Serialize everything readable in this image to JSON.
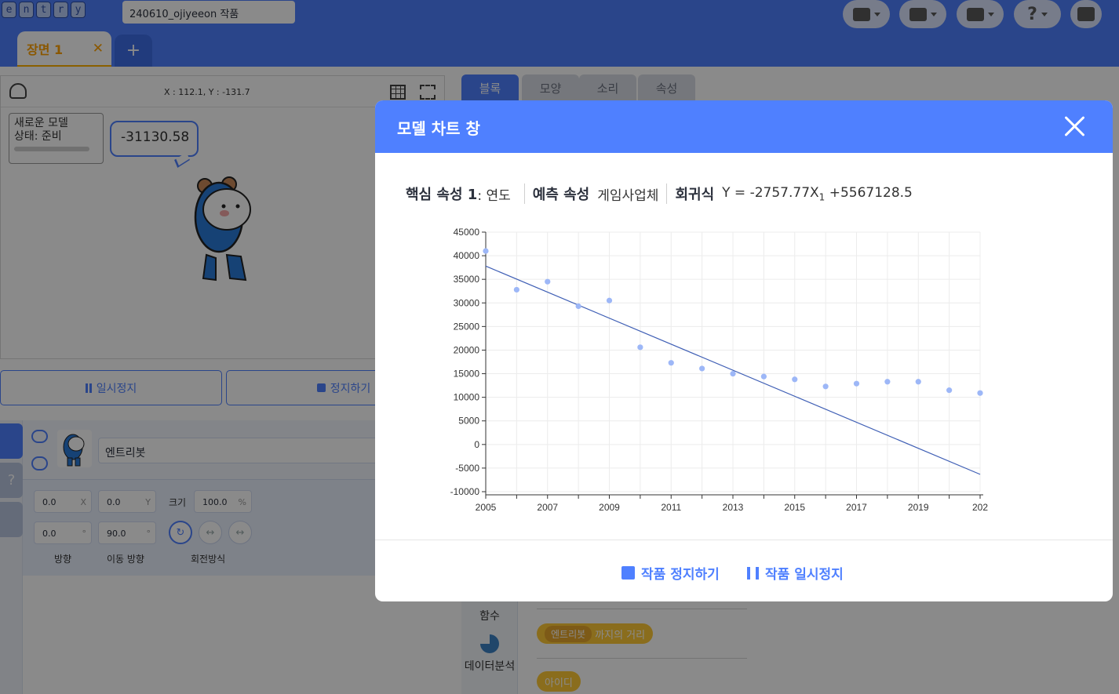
{
  "logo_letters": [
    "e",
    "n",
    "t",
    "r",
    "y"
  ],
  "project": {
    "title": "240610_ojiyeeon 작품"
  },
  "toolbar": {
    "icons": [
      "block-mode-icon",
      "file-icon",
      "save-icon",
      "help-icon",
      "print-icon"
    ],
    "help_label": "?"
  },
  "scene": {
    "tab_label": "장면 1",
    "close_glyph": "✕",
    "add_glyph": "+"
  },
  "stage": {
    "coords": "X : 112.1, Y : -131.7",
    "model_box": {
      "name": "새로운 모델",
      "status": "상태: 준비"
    },
    "bubble_text": "-31130.58"
  },
  "controls": {
    "pause_label": "일시정지",
    "stop_label": "정지하기"
  },
  "object": {
    "name": "엔트리봇",
    "x": "0.0",
    "y": "0.0",
    "x_unit": "X",
    "y_unit": "Y",
    "size_label": "크기",
    "size": "100.0",
    "size_unit": "%",
    "direction": "0.0",
    "move_direction": "90.0",
    "degree_unit": "°",
    "direction_label": "방향",
    "move_direction_label": "이동 방향",
    "rotation_label": "회전방식"
  },
  "block_tabs": [
    "블록",
    "모양",
    "소리",
    "속성"
  ],
  "categories": {
    "function": "함수",
    "data_analysis": "데이터분석"
  },
  "blocks": {
    "target": "엔트리봇",
    "distance": "까지의 거리",
    "id": "아이디"
  },
  "modal": {
    "title": "모델 차트 창",
    "core_label": "핵심 속성 1",
    "core_value": ": 연도",
    "predict_label": "예측 속성",
    "predict_value": "게임사업체",
    "formula_label": "회귀식",
    "formula_prefix": "Y = -2757.77X",
    "formula_sub": "1",
    "formula_suffix": " +5567128.5",
    "stop_label": "작품 정지하기",
    "pause_label": "작품 일시정지"
  },
  "chart_data": {
    "type": "scatter",
    "points_color": "#9db7f7",
    "line_color": "#3f5fb5",
    "x": [
      2005,
      2006,
      2007,
      2008,
      2009,
      2010,
      2011,
      2012,
      2013,
      2014,
      2015,
      2016,
      2017,
      2018,
      2019,
      2020,
      2021
    ],
    "y": [
      41000,
      32800,
      34500,
      29300,
      30500,
      20600,
      17300,
      16100,
      15000,
      14400,
      13800,
      12300,
      12900,
      13300,
      13300,
      11500,
      10900
    ],
    "regression": {
      "slope": -2757.77,
      "intercept": 5567128.5
    },
    "xlim": [
      2005,
      2021
    ],
    "ylim": [
      -10000,
      45000
    ],
    "x_tick_labels": [
      "2005",
      "2007",
      "2009",
      "2011",
      "2013",
      "2015",
      "2017",
      "2019",
      "202"
    ],
    "y_tick_labels": [
      "45000",
      "40000",
      "35000",
      "30000",
      "25000",
      "20000",
      "15000",
      "10000",
      "5000",
      "0",
      "-5000",
      "-10000"
    ],
    "grid": true
  }
}
